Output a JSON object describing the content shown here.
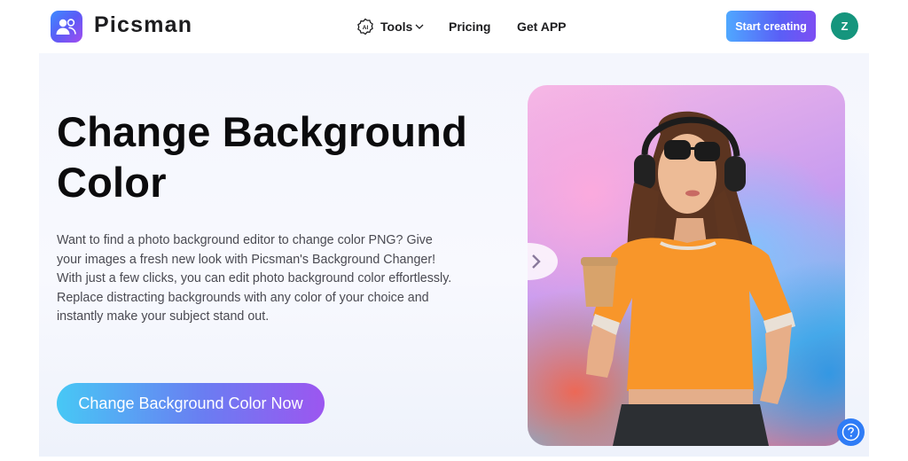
{
  "brand": {
    "name": "Picsman",
    "accent": "#5b5cf6"
  },
  "nav": {
    "tools_label": "Tools",
    "ai_badge": "AI",
    "pricing_label": "Pricing",
    "getapp_label": "Get APP"
  },
  "header": {
    "start_label": "Start creating",
    "avatar_initial": "Z",
    "avatar_color": "#15957d"
  },
  "hero": {
    "title_line1": "Change Background",
    "title_line2": "Color",
    "desc_p1": "Want to find a photo background editor to change color PNG? Give your images a fresh new look with Picsman's Background Changer!",
    "desc_p2": "With just a few clicks, you can edit photo background color effortlessly. Replace distracting backgrounds with any color of your choice and instantly make your subject stand out.",
    "cta_label": "Change Background Color Now"
  },
  "icons": [
    "logo-icon",
    "ai-tools-icon",
    "chevron-down-icon",
    "compare-slider-icon",
    "help-icon"
  ]
}
